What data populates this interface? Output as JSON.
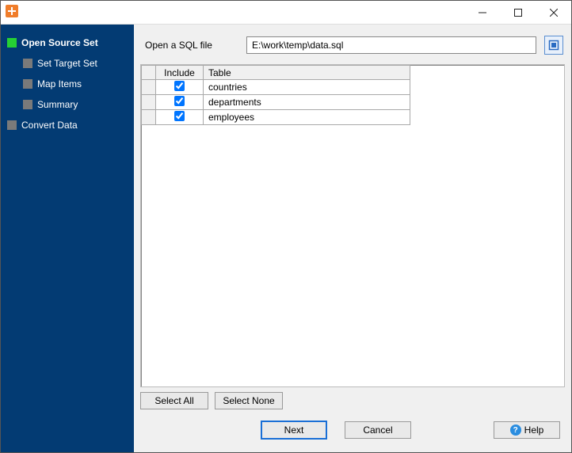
{
  "window": {
    "title": ""
  },
  "sidebar": {
    "steps": [
      {
        "label": "Open Source Set",
        "active": true,
        "child": false
      },
      {
        "label": "Set Target Set",
        "active": false,
        "child": true
      },
      {
        "label": "Map Items",
        "active": false,
        "child": true
      },
      {
        "label": "Summary",
        "active": false,
        "child": true
      },
      {
        "label": "Convert Data",
        "active": false,
        "child": false
      }
    ]
  },
  "file": {
    "label": "Open a SQL file",
    "path": "E:\\work\\temp\\data.sql"
  },
  "table": {
    "headers": {
      "include": "Include",
      "table": "Table"
    },
    "rows": [
      {
        "checked": true,
        "name": "countries"
      },
      {
        "checked": true,
        "name": "departments"
      },
      {
        "checked": true,
        "name": "employees"
      }
    ]
  },
  "buttons": {
    "select_all": "Select All",
    "select_none": "Select None",
    "next": "Next",
    "cancel": "Cancel",
    "help": "Help"
  }
}
